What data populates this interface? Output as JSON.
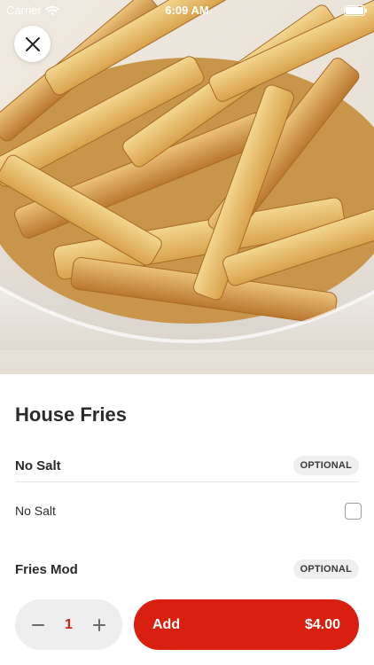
{
  "status_bar": {
    "carrier": "Carrier",
    "time": "6:09 AM"
  },
  "item": {
    "title": "House Fries",
    "image_subject": "bowl of house fries"
  },
  "modifier_groups": [
    {
      "label": "No Salt",
      "badge": "OPTIONAL",
      "options": [
        {
          "label": "No Salt",
          "checked": false
        }
      ]
    },
    {
      "label": "Fries Mod",
      "badge": "OPTIONAL",
      "options": []
    }
  ],
  "cart": {
    "quantity": "1",
    "add_label": "Add",
    "price": "$4.00"
  },
  "colors": {
    "accent_red": "#d92010",
    "quantity_red": "#d4200f",
    "badge_bg": "#efefef"
  },
  "icons": {
    "close": "close-icon",
    "decrement": "minus-icon",
    "increment": "plus-icon",
    "wifi": "wifi-icon",
    "battery": "battery-icon"
  }
}
